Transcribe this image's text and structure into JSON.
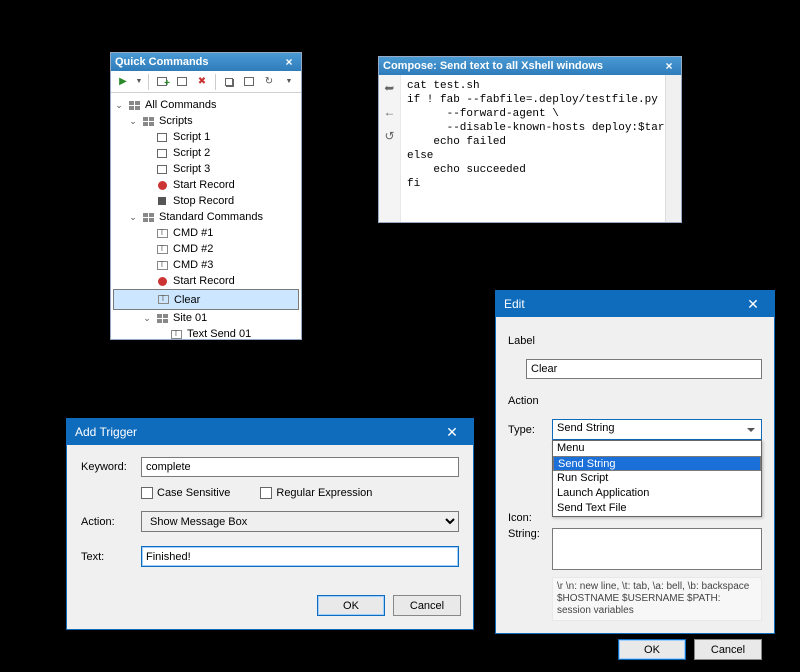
{
  "quick_commands": {
    "title": "Quick Commands",
    "tree": {
      "root": "All Commands",
      "scripts": {
        "label": "Scripts",
        "items": [
          "Script 1",
          "Script 2",
          "Script 3",
          "Start Record",
          "Stop Record"
        ]
      },
      "standard": {
        "label": "Standard Commands",
        "cmds": [
          "CMD #1",
          "CMD #2",
          "CMD #3"
        ],
        "start_record": "Start Record",
        "clear": "Clear",
        "site": {
          "label": "Site 01",
          "item": "Text Send 01"
        }
      }
    }
  },
  "compose": {
    "title": "Compose: Send text to all Xshell windows",
    "text": "cat test.sh\nif ! fab --fabfile=.deploy/testfile.py \\\n      --forward-agent \\\n      --disable-known-hosts deploy:$target; then\n    echo failed\nelse\n    echo succeeded\nfi"
  },
  "add_trigger": {
    "title": "Add Trigger",
    "labels": {
      "keyword": "Keyword:",
      "action": "Action:",
      "text": "Text:",
      "case": "Case Sensitive",
      "regex": "Regular Expression"
    },
    "values": {
      "keyword": "complete",
      "action": "Show Message Box",
      "text": "Finished!"
    },
    "buttons": {
      "ok": "OK",
      "cancel": "Cancel"
    }
  },
  "edit": {
    "title": "Edit",
    "group_label": "Label",
    "group_action": "Action",
    "labels": {
      "type": "Type:",
      "icon": "Icon:",
      "string": "String:"
    },
    "label_value": "Clear",
    "type_value": "Send String",
    "type_options": [
      "Menu",
      "Send String",
      "Run Script",
      "Launch Application",
      "Send Text File"
    ],
    "hint_line1": "\\r \\n: new line,  \\t: tab,  \\a: bell,  \\b: backspace",
    "hint_line2": "$HOSTNAME $USERNAME $PATH: session variables",
    "buttons": {
      "ok": "OK",
      "cancel": "Cancel"
    }
  }
}
